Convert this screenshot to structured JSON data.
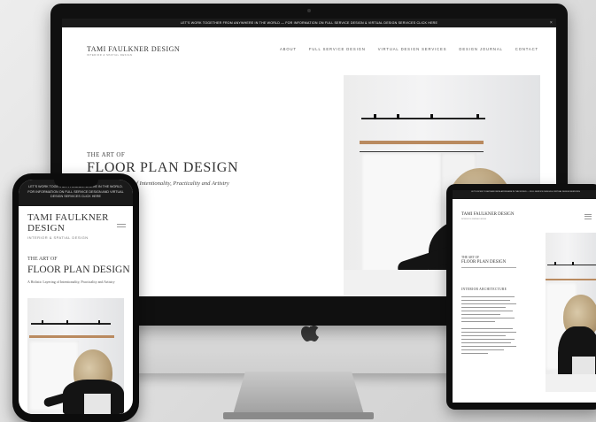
{
  "desktop": {
    "announcement": "LET'S WORK TOGETHER FROM ANYWHERE IN THE WORLD — FOR INFORMATION ON FULL SERVICE DESIGN & VIRTUAL DESIGN SERVICES CLICK HERE",
    "close_glyph": "×",
    "logo": "TAMI FAULKNER DESIGN",
    "tagline": "INTERIOR & SPATIAL DESIGN",
    "nav": [
      "ABOUT",
      "FULL SERVICE DESIGN",
      "VIRTUAL DESIGN SERVICES",
      "DESIGN JOURNAL",
      "CONTACT"
    ],
    "hero": {
      "eyebrow": "THE ART OF",
      "title": "FLOOR PLAN DESIGN",
      "subtitle": "A Holistic Layering of Intentionality, Practicality and Artistry"
    }
  },
  "mobile": {
    "announcement": "LET'S WORK TOGETHER FROM ANYWHERE IN THE WORLD. FOR INFORMATION ON FULL SERVICE DESIGN AND VIRTUAL DESIGN SERVICES CLICK HERE",
    "logo_line1": "TAMI FAULKNER",
    "logo_line2": "DESIGN",
    "tagline": "INTERIOR & SPATIAL DESIGN",
    "eyebrow": "THE ART OF",
    "title": "FLOOR PLAN DESIGN",
    "subtitle": "A Holistic Layering of Intentionality, Practicality and Artistry"
  },
  "tablet": {
    "announcement": "LET'S WORK TOGETHER FROM ANYWHERE IN THE WORLD — FULL SERVICE DESIGN & VIRTUAL DESIGN SERVICES",
    "logo": "TAMI FAULKNER DESIGN",
    "tagline": "INTERIOR & SPATIAL DESIGN",
    "eyebrow": "THE ART OF",
    "title": "FLOOR PLAN DESIGN",
    "section_heading": "INTERIOR ARCHITECTURE"
  },
  "colors": {
    "bezel": "#101010",
    "announcement_bar": "#1a1a1a",
    "text": "#333333",
    "photo_wood": "#b98a5f"
  },
  "icons": [
    "apple-logo-icon",
    "close-icon",
    "hamburger-menu-icon"
  ]
}
